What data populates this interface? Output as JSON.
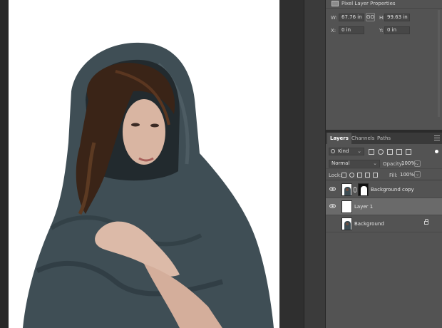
{
  "properties": {
    "title": "Pixel Layer Properties",
    "w_label": "W:",
    "w_value": "67.76 in",
    "link_label": "GO",
    "h_label": "H:",
    "h_value": "99.63 in",
    "x_label": "X:",
    "x_value": "0 in",
    "y_label": "Y:",
    "y_value": "0 in"
  },
  "layers_panel": {
    "tabs": [
      "Layers",
      "Channels",
      "Paths"
    ],
    "active_tab": "Layers",
    "filter_kind": "Kind",
    "blend_mode": "Normal",
    "opacity_label": "Opacity:",
    "opacity_value": "100%",
    "lock_label": "Lock:",
    "fill_label": "Fill:",
    "fill_value": "100%",
    "layers": [
      {
        "name": "Background copy",
        "visible": true,
        "has_mask": true,
        "selected": false,
        "locked": false
      },
      {
        "name": "Layer 1",
        "visible": true,
        "has_mask": false,
        "selected": true,
        "locked": false
      },
      {
        "name": "Background",
        "visible": false,
        "has_mask": false,
        "selected": false,
        "locked": true
      }
    ]
  },
  "colors": {
    "panel_bg": "#535353",
    "panel_dark": "#3a3a3a",
    "selected_row": "#6a6a6a",
    "canvas_bg": "#ffffff",
    "scarf": "#3f4e55",
    "hair": "#3a2417",
    "skin": "#d9b5a2"
  }
}
